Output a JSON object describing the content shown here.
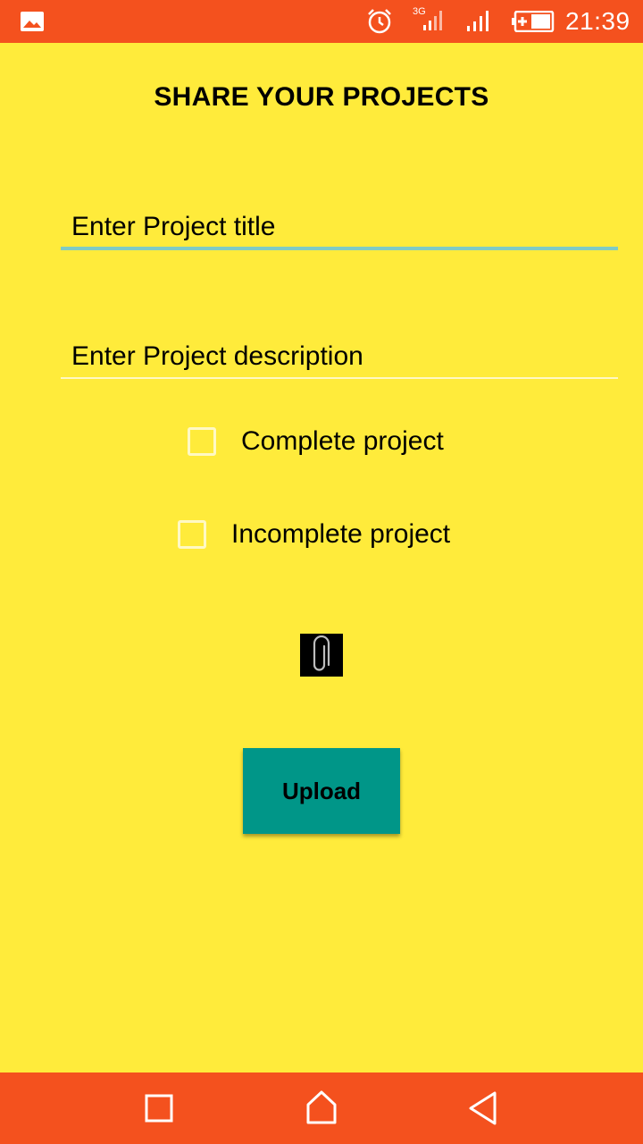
{
  "status_bar": {
    "time": "21:39",
    "network": "3G",
    "icons": [
      "gallery-icon",
      "alarm-icon",
      "signal-3g-icon",
      "signal-icon",
      "battery-icon"
    ],
    "background_color": "#F4511E"
  },
  "page": {
    "title": "SHARE YOUR PROJECTS",
    "background_color": "#FFEB3B"
  },
  "form": {
    "title_placeholder": "Enter Project title",
    "title_value": "",
    "description_placeholder": "Enter Project description",
    "description_value": "",
    "complete_label": "Complete project",
    "complete_checked": false,
    "incomplete_label": "Incomplete project",
    "incomplete_checked": false,
    "attach_icon": "paperclip-icon",
    "upload_label": "Upload",
    "upload_color": "#009688"
  },
  "nav_bar": {
    "icons": [
      "recents-icon",
      "home-icon",
      "back-icon"
    ],
    "background_color": "#F4511E"
  }
}
